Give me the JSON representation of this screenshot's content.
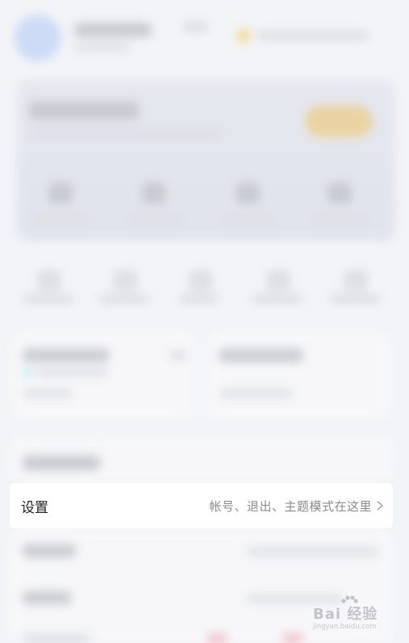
{
  "settings": {
    "label": "设置",
    "description": "帐号、退出、主题模式在这里",
    "chevron_icon": "chevron-right-icon"
  },
  "watermark": {
    "text": "Bai 经验",
    "url": "jingyan.baidu.com"
  },
  "colors": {
    "background": "#f3f4f7",
    "vip_accent": "#ebcf99",
    "row_background": "#ffffff"
  }
}
